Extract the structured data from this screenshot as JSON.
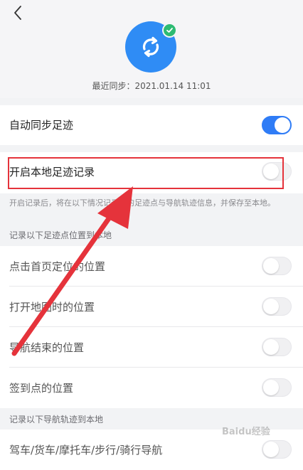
{
  "header": {
    "back_icon": "chevron-left-icon",
    "sync_icon": "sync-icon",
    "badge_icon": "check-badge-icon",
    "last_sync": "最近同步：2021.01.14 11:01"
  },
  "auto_sync": {
    "label": "自动同步足迹",
    "on": true
  },
  "local_record": {
    "label": "开启本地足迹记录",
    "on": false
  },
  "local_note": "开启记录后，将在以下情况记录您的足迹点与导航轨迹信息，并保存至本地。",
  "section_points": {
    "title": "记录以下足迹点位置到本地",
    "items": [
      {
        "label": "点击首页定位的位置",
        "on": false
      },
      {
        "label": "打开地图时的位置",
        "on": false
      },
      {
        "label": "导航结束的位置",
        "on": false
      },
      {
        "label": "签到点的位置",
        "on": false
      }
    ]
  },
  "section_tracks": {
    "title": "记录以下导航轨迹到本地",
    "items": [
      {
        "label": "驾车/货车/摩托车/步行/骑行导航",
        "on": false
      }
    ]
  },
  "colors": {
    "accent": "#2f7cf6",
    "highlight": "#e5333b",
    "badge": "#2dbb73"
  },
  "watermark": "Baidu经验"
}
